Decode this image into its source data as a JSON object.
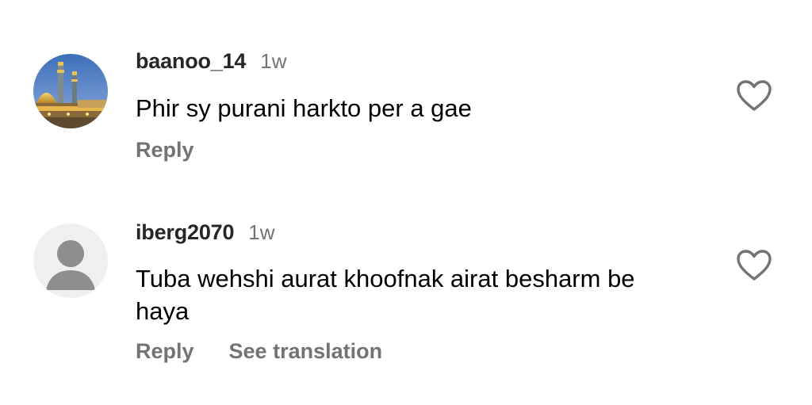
{
  "comments": [
    {
      "username": "baanoo_14",
      "time": "1w",
      "text": "Phir sy purani harkto per a gae",
      "reply_label": "Reply",
      "avatar_icon": "shrine-photo-avatar",
      "like_icon": "heart-outline-icon"
    },
    {
      "username": "iberg2070",
      "time": "1w",
      "text": "Tuba wehshi aurat khoofnak airat besharm be haya",
      "reply_label": "Reply",
      "translate_label": "See translation",
      "avatar_icon": "default-person-avatar",
      "like_icon": "heart-outline-icon"
    }
  ],
  "colors": {
    "username": "#262626",
    "secondary_text": "#737373",
    "body_text": "#000000",
    "default_avatar_bg": "#efefef",
    "default_avatar_figure": "#8e8e8e"
  }
}
